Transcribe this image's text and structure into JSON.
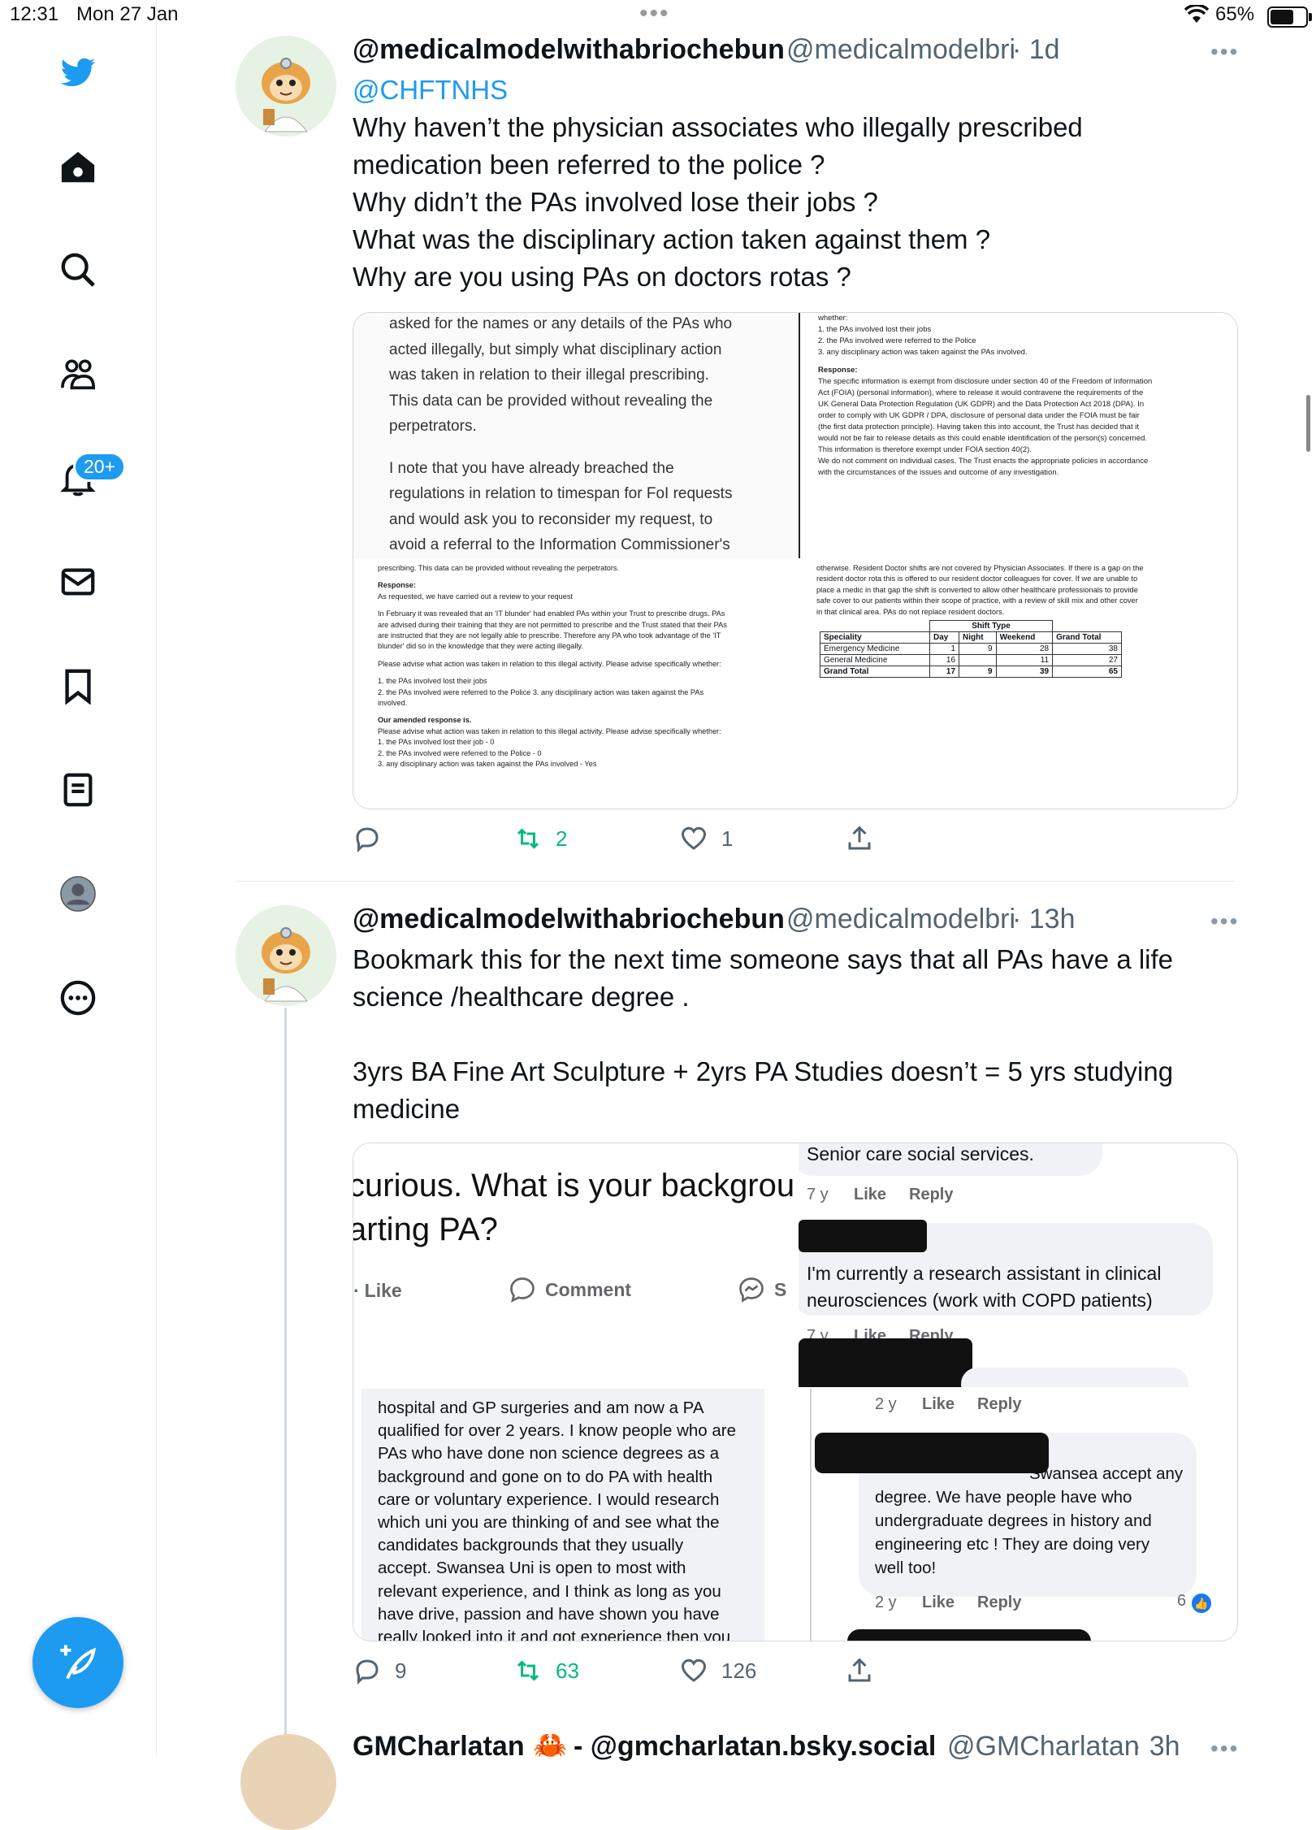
{
  "status_bar": {
    "time": "12:31",
    "date": "Mon 27 Jan",
    "dots": "•••",
    "battery": "65%"
  },
  "sidebar": {
    "notifications_badge": "20+"
  },
  "tweet1": {
    "display_name": "@medicalmodelwithabriochebun",
    "handle": "@medicalmodelbri",
    "time": "· 1d",
    "mention": "@CHFTNHS",
    "lines": [
      "Why haven’t the physician associates who illegally prescribed",
      "medication been referred to the police ?",
      "Why didn’t the PAs involved lose their jobs ?",
      "What was the disciplinary action taken against them ?",
      "Why are you using PAs on doctors rotas ?"
    ],
    "media": {
      "tl_lines": [
        "asked for the names or any details of the PAs who",
        "acted illegally, but simply what disciplinary action",
        "was taken in relation to their illegal prescribing.",
        "This data can be provided without revealing the",
        "perpetrators.",
        "",
        "I note that you have already breached the",
        "regulations in relation to timespan for FoI requests",
        "and would ask you to reconsider my request, to",
        "avoid a referral to the Information Commissioner's"
      ],
      "tr_lines": [
        "whether:",
        "1. the PAs involved lost their jobs",
        "2. the PAs involved were referred to the Police",
        "3. any disciplinary action was taken against the PAs involved.",
        "",
        "Response:",
        "The specific information is exempt from disclosure under section 40 of the Freedom of Information",
        "Act (FOIA) (personal information), where to release it would contravene the requirements of the",
        "UK General Data Protection Regulation (UK GDPR) and the Data Protection Act 2018 (DPA). In",
        "order to comply with UK GDPR / DPA, disclosure of personal data under the FOIA must be fair",
        "(the first data protection principle). Having taken this into account, the Trust has decided that it",
        "would not be fair to release details as this could enable identification of the person(s) concerned.",
        "This information is therefore exempt under FOIA section 40(2).",
        "We do not comment on individual cases. The Trust enacts the appropriate policies in accordance",
        "with the circumstances of the issues and outcome of any investigation."
      ],
      "bl_lines": [
        "prescribing. This data can be provided without revealing the perpetrators.",
        "",
        "Response:",
        "As requested, we have carried out a review to your request",
        "",
        "In February it was revealed that an 'IT blunder' had enabled PAs within your Trust to prescribe drugs. PAs",
        "are advised during their training that they are not permitted to prescribe and the Trust stated that their PAs",
        "are instructed that they are not legally able to prescribe. Therefore any PA who took advantage of the 'IT",
        "blunder' did so in the knowledge that they were acting illegally.",
        "",
        "Please advise what action was taken in relation to this illegal activity. Please advise specifically whether:",
        "",
        "1. the PAs involved lost their jobs",
        "2. the PAs involved were referred to the Police 3. any disciplinary action was taken against the PAs",
        "involved.",
        "",
        "Our amended response is.",
        "Please advise what action was taken in relation to this illegal activity. Please advise specifically whether:",
        "1. the PAs involved lost their job - 0",
        "2. the PAs involved were referred to the Police - 0",
        "3. any disciplinary action was taken against the PAs involved - Yes"
      ],
      "br_lines": [
        "otherwise. Resident Doctor shifts are not covered by Physician Associates. If there is a gap on the",
        "resident doctor rota this is offered to our resident doctor colleagues for cover. If we are unable to",
        "place a medic in that gap the shift is converted to allow other healthcare professionals to provide",
        "safe cover to our patients within their scope of practice, with a review of skill mix and other cover",
        "in that clinical area. PAs do not replace resident doctors."
      ],
      "table": {
        "group_header": "Shift Type",
        "headers": [
          "Speciality",
          "Day",
          "Night",
          "Weekend",
          "Grand Total"
        ],
        "rows": [
          [
            "Emergency Medicine",
            "1",
            "9",
            "28",
            "38"
          ],
          [
            "General Medicine",
            "16",
            "",
            "11",
            "27"
          ],
          [
            "Grand Total",
            "17",
            "9",
            "39",
            "65"
          ]
        ]
      }
    },
    "actions": {
      "replies": "",
      "retweets": "2",
      "likes": "1"
    }
  },
  "tweet2": {
    "display_name": "@medicalmodelwithabriochebun",
    "handle": "@medicalmodelbri",
    "time": "· 13h",
    "lines": [
      "Bookmark this for the next time someone says that all PAs have a life",
      "science /healthcare degree .",
      "",
      "3yrs BA Fine Art Sculpture + 2yrs PA Studies doesn’t = 5 yrs studying",
      "medicine"
    ],
    "media": {
      "question_line1": "curious. What is your backgrou",
      "question_line2": "arting PA?",
      "fb_like": "Like",
      "fb_comment": "Comment",
      "fb_share": "S",
      "comment1": "Senior care social services.",
      "c1_age": "7 y",
      "like": "Like",
      "reply": "Reply",
      "comment2_line1": "I'm currently a research assistant in clinical",
      "comment2_line2": "neurosciences (work with COPD patients)",
      "c2_age": "7 y",
      "c3_age": "2 y",
      "long_comment": [
        "hospital and GP surgeries and am now a PA",
        "qualified for over 2 years. I know people who are",
        "PAs who have done non science degrees as a",
        "background and gone on to do PA with health",
        "care or voluntary experience. I would research",
        "which uni you are thinking of and see what the",
        "candidates backgrounds that they usually",
        "accept. Swansea Uni is open to most with",
        "relevant experience, and I think as long as you",
        "have drive, passion and have shown you have",
        "really looked into it and got experience then you"
      ],
      "comment4": [
        "Swansea accept any",
        "degree. We have people have who",
        "undergraduate degrees in history and",
        "engineering etc ! They are doing very",
        "well too!"
      ],
      "c4_age": "2 y",
      "c4_reactions": "6"
    },
    "actions": {
      "replies": "9",
      "retweets": "63",
      "likes": "126"
    }
  },
  "tweet3": {
    "display_name": "GMCharlatan",
    "handle_text": "- @gmcharlatan.bsky.social",
    "handle": "@GMCharlatan",
    "time": "· 3h"
  }
}
